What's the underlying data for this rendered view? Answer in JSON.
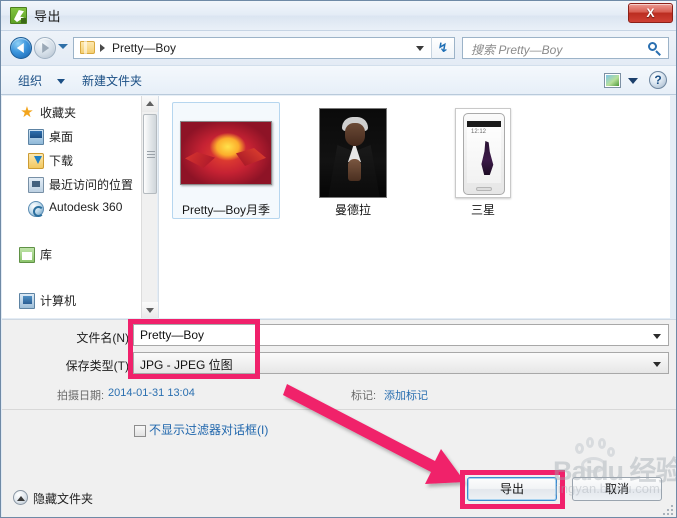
{
  "window": {
    "title": "导出",
    "app_icon": "export-app-icon",
    "close_label": "X"
  },
  "nav": {
    "back_icon": "back-arrow-icon",
    "forward_icon": "forward-arrow-icon",
    "recent_dropdown_icon": "chevron-down-icon",
    "folder_icon": "folder-icon",
    "breadcrumb": "Pretty—Boy",
    "path_dropdown_icon": "chevron-down-icon",
    "refresh_icon": "↯",
    "search_placeholder": "搜索 Pretty—Boy",
    "search_icon": "search-icon"
  },
  "toolbar": {
    "organize": "组织",
    "organize_caret": "chevron-down-icon",
    "new_folder": "新建文件夹",
    "view_icon": "view-mode-icon",
    "view_caret": "chevron-down-icon",
    "help": "?"
  },
  "sidebar": {
    "groups": [
      {
        "label": "收藏夹",
        "icon": "star-icon",
        "level": "head"
      },
      {
        "label": "桌面",
        "icon": "desktop-icon",
        "level": "sub"
      },
      {
        "label": "下载",
        "icon": "download-icon",
        "level": "sub"
      },
      {
        "label": "最近访问的位置",
        "icon": "recent-places-icon",
        "level": "sub"
      },
      {
        "label": "Autodesk 360",
        "icon": "autodesk-icon",
        "level": "sub"
      },
      {
        "label": "库",
        "icon": "library-icon",
        "level": "head"
      },
      {
        "label": "计算机",
        "icon": "computer-icon",
        "level": "head"
      }
    ],
    "scrollbar_up_icon": "caret-up-icon",
    "scrollbar_down_icon": "caret-down-icon"
  },
  "files": [
    {
      "name": "Pretty—Boy月季",
      "thumb": "rose-photo-thumbnail",
      "selected": true
    },
    {
      "name": "曼德拉",
      "thumb": "portrait-photo-thumbnail",
      "selected": false
    },
    {
      "name": "三星",
      "thumb": "phone-photo-thumbnail",
      "selected": false
    }
  ],
  "form": {
    "filename_label": "文件名(N)",
    "filename_value": "Pretty—Boy",
    "filename_caret": "chevron-down-icon",
    "savetype_label": "保存类型(T)",
    "savetype_value": "JPG - JPEG 位图",
    "savetype_caret": "chevron-down-icon",
    "date_label": "拍摄日期:",
    "date_value": "2014-01-31 13:04",
    "tags_label": "标记:",
    "tags_value": "添加标记"
  },
  "options": {
    "filter_checkbox_label": "不显示过滤器对话框(I)",
    "filter_checkbox_checked": false
  },
  "footer": {
    "hide_folders": "隐藏文件夹",
    "hide_folders_icon": "collapse-up-icon",
    "export_button": "导出",
    "cancel_button": "取消"
  },
  "annotations": {
    "highlight_color": "#f0216b",
    "arrow_from": "保存类型字段",
    "arrow_to": "导出按钮"
  },
  "watermark": {
    "brand": "Baidu 经验",
    "url": "jingyan.baidu.com"
  }
}
